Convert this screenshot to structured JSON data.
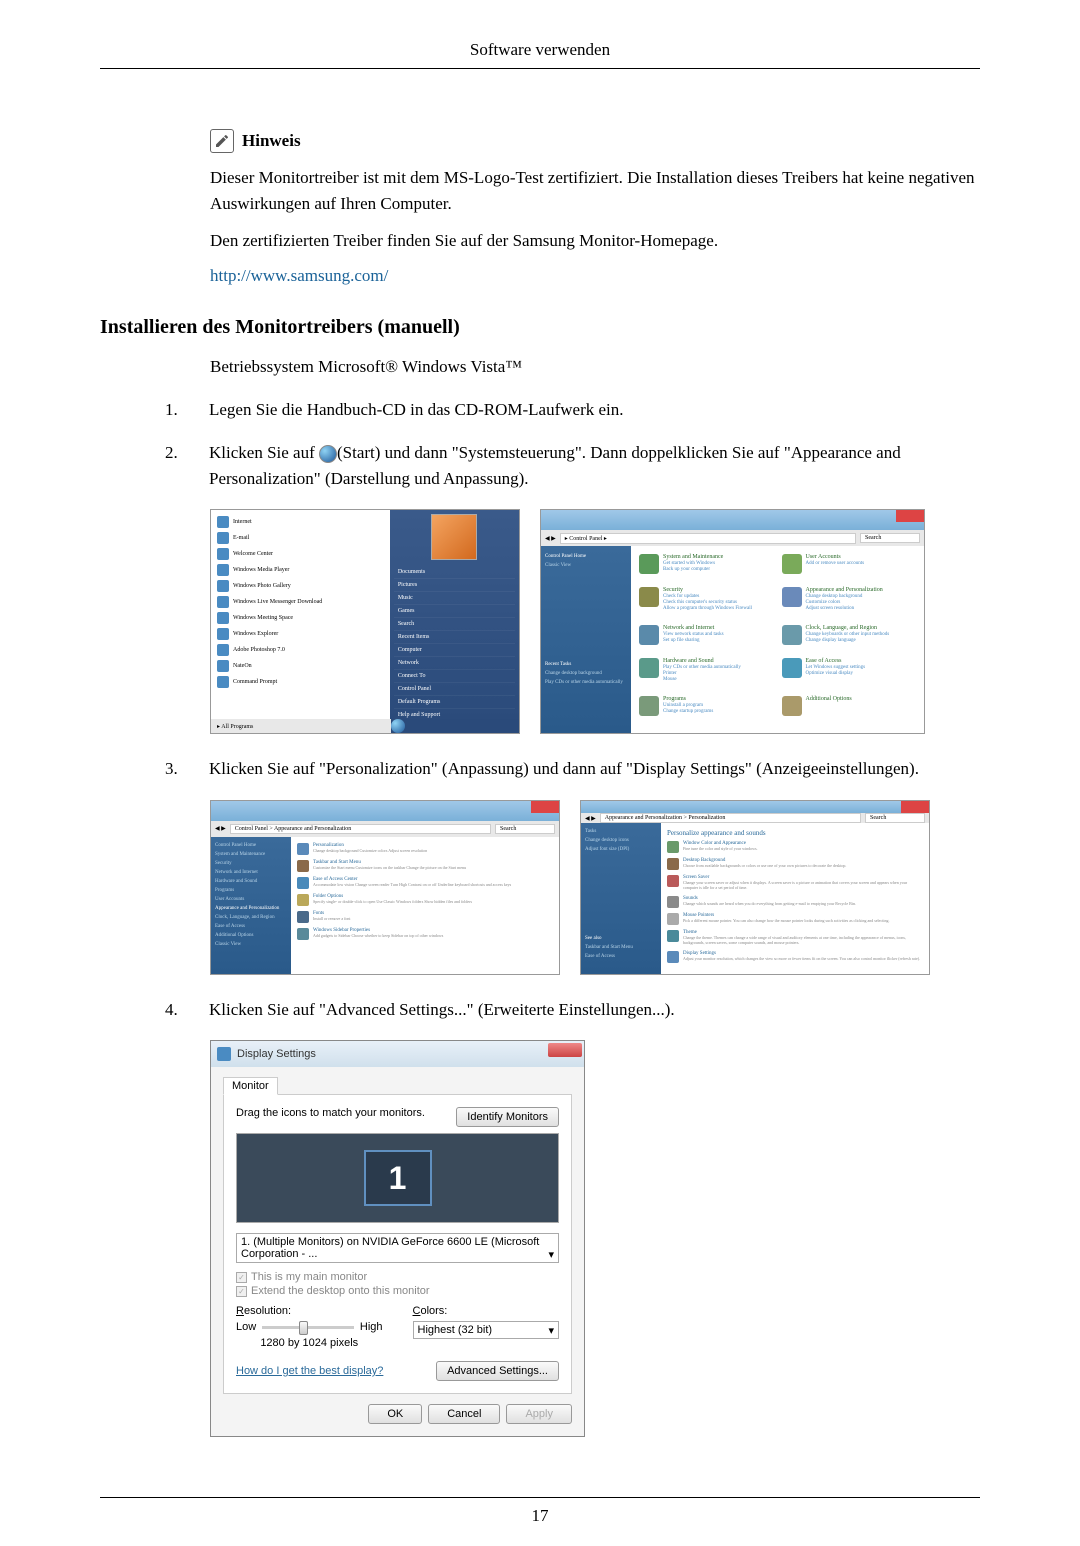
{
  "header_title": "Software verwenden",
  "hint": {
    "label": "Hinweis",
    "paragraph1": "Dieser Monitortreiber ist mit dem MS-Logo-Test zertifiziert. Die Installation dieses Treibers hat keine negativen Auswirkungen auf Ihren Computer.",
    "paragraph2": "Den zertifizierten Treiber finden Sie auf der Samsung Monitor-Homepage.",
    "url": "http://www.samsung.com/"
  },
  "section_heading": "Installieren des Monitortreibers (manuell)",
  "os_line": "Betriebssystem Microsoft® Windows Vista™",
  "steps": {
    "s1": {
      "num": "1.",
      "text": "Legen Sie die Handbuch-CD in das CD-ROM-Laufwerk ein."
    },
    "s2": {
      "num": "2.",
      "text_before": "Klicken Sie auf ",
      "text_after": "(Start) und dann \"Systemsteuerung\". Dann doppelklicken Sie auf \"Appearance and Personalization\" (Darstellung und Anpassung)."
    },
    "s3": {
      "num": "3.",
      "text": "Klicken Sie auf \"Personalization\" (Anpassung) und dann auf \"Display Settings\" (Anzeigeeinstellungen)."
    },
    "s4": {
      "num": "4.",
      "text": "Klicken Sie auf \"Advanced Settings...\" (Erweiterte Einstellungen...)."
    }
  },
  "startmenu": {
    "left_items": [
      "Internet",
      "E-mail",
      "Welcome Center",
      "Windows Media Player",
      "Windows Photo Gallery",
      "Windows Live Messenger Download",
      "Windows Meeting Space",
      "Windows Explorer",
      "Adobe Photoshop 7.0",
      "NateOn",
      "Command Prompt"
    ],
    "all_programs": "All Programs",
    "right_items": [
      "Documents",
      "Pictures",
      "Music",
      "Games",
      "Search",
      "Recent Items",
      "Computer",
      "Network",
      "Connect To",
      "Control Panel",
      "Default Programs",
      "Help and Support"
    ]
  },
  "control_panel": {
    "address": "Control Panel",
    "search": "Search",
    "sidebar_header": "Control Panel Home",
    "sidebar_items": [
      "Classic View"
    ],
    "sidebar_recent": "Recent Tasks",
    "sidebar_recent_items": [
      "Change desktop background",
      "Play CDs or other media automatically"
    ],
    "cats": [
      {
        "title": "System and Maintenance",
        "sub": "Get started with Windows\nBack up your computer",
        "color": "#5a9a5a"
      },
      {
        "title": "User Accounts",
        "sub": "Add or remove user accounts",
        "color": "#7aaa5a"
      },
      {
        "title": "Security",
        "sub": "Check for updates\nCheck this computer's security status\nAllow a program through Windows Firewall",
        "color": "#8a8a4a"
      },
      {
        "title": "Appearance and Personalization",
        "sub": "Change desktop background\nCustomize colors\nAdjust screen resolution",
        "color": "#6a8aba"
      },
      {
        "title": "Network and Internet",
        "sub": "View network status and tasks\nSet up file sharing",
        "color": "#5a8aaa"
      },
      {
        "title": "Clock, Language, and Region",
        "sub": "Change keyboards or other input methods\nChange display language",
        "color": "#6a9aaa"
      },
      {
        "title": "Hardware and Sound",
        "sub": "Play CDs or other media automatically\nPrinter\nMouse",
        "color": "#5a9a8a"
      },
      {
        "title": "Ease of Access",
        "sub": "Let Windows suggest settings\nOptimize visual display",
        "color": "#4a9aba"
      },
      {
        "title": "Programs",
        "sub": "Uninstall a program\nChange startup programs",
        "color": "#7a9a7a"
      },
      {
        "title": "Additional Options",
        "sub": "",
        "color": "#aa9a6a"
      }
    ]
  },
  "personalization1": {
    "address": "Control Panel > Appearance and Personalization",
    "sidebar": [
      "Control Panel Home",
      "System and Maintenance",
      "Security",
      "Network and Internet",
      "Hardware and Sound",
      "Programs",
      "User Accounts",
      "Appearance and Personalization",
      "Clock, Language, and Region",
      "Ease of Access",
      "Additional Options",
      "Classic View"
    ],
    "items": [
      {
        "title": "Personalization",
        "desc": "Change desktop background  Customize colors  Adjust screen resolution",
        "color": "#5a8aba"
      },
      {
        "title": "Taskbar and Start Menu",
        "desc": "Customize the Start menu  Customize icons on the taskbar  Change the picture on the Start menu",
        "color": "#8a6a4a"
      },
      {
        "title": "Ease of Access Center",
        "desc": "Accommodate low vision  Change screen reader  Turn High Contrast on or off  Underline keyboard shortcuts and access keys",
        "color": "#4a8aba"
      },
      {
        "title": "Folder Options",
        "desc": "Specify single- or double-click to open  Use Classic Windows folders  Show hidden files and folders",
        "color": "#baa85a"
      },
      {
        "title": "Fonts",
        "desc": "Install or remove a font",
        "color": "#4a6a8a"
      },
      {
        "title": "Windows Sidebar Properties",
        "desc": "Add gadgets to Sidebar  Choose whether to keep Sidebar on top of other windows",
        "color": "#5a8a9a"
      }
    ]
  },
  "personalization2": {
    "address": "Appearance and Personalization > Personalization",
    "heading": "Personalize appearance and sounds",
    "sidebar": [
      "Tasks",
      "Change desktop icons",
      "Adjust font size (DPI)"
    ],
    "items": [
      {
        "title": "Window Color and Appearance",
        "desc": "Fine tune the color and style of your windows.",
        "color": "#6a9a6a"
      },
      {
        "title": "Desktop Background",
        "desc": "Choose from available backgrounds or colors or use one of your own pictures to decorate the desktop.",
        "color": "#8a6a4a"
      },
      {
        "title": "Screen Saver",
        "desc": "Change your screen saver or adjust when it displays. A screen saver is a picture or animation that covers your screen and appears when your computer is idle for a set period of time.",
        "color": "#ba5a5a"
      },
      {
        "title": "Sounds",
        "desc": "Change which sounds are heard when you do everything from getting e-mail to emptying your Recycle Bin.",
        "color": "#8a8a8a"
      },
      {
        "title": "Mouse Pointers",
        "desc": "Pick a different mouse pointer. You can also change how the mouse pointer looks during such activities as clicking and selecting.",
        "color": "#aaaaaa"
      },
      {
        "title": "Theme",
        "desc": "Change the theme. Themes can change a wide range of visual and auditory elements at one time, including the appearance of menus, icons, backgrounds, screen savers, some computer sounds, and mouse pointers.",
        "color": "#4a8a9a"
      },
      {
        "title": "Display Settings",
        "desc": "Adjust your monitor resolution, which changes the view so more or fewer items fit on the screen. You can also control monitor flicker (refresh rate).",
        "color": "#5a8aba"
      }
    ],
    "see_also": "See also",
    "see_also_items": [
      "Taskbar and Start Menu",
      "Ease of Access"
    ]
  },
  "display_settings": {
    "title": "Display Settings",
    "tab": "Monitor",
    "drag_text": "Drag the icons to match your monitors.",
    "identify_button": "Identify Monitors",
    "monitor_number": "1",
    "monitor_select": "1. (Multiple Monitors) on NVIDIA GeForce 6600 LE (Microsoft Corporation - ...",
    "checkbox1": "This is my main monitor",
    "checkbox2": "Extend the desktop onto this monitor",
    "resolution_label": "Resolution:",
    "slider_low": "Low",
    "slider_high": "High",
    "resolution_value": "1280 by 1024 pixels",
    "colors_label": "Colors:",
    "colors_value": "Highest (32 bit)",
    "help_link": "How do I get the best display?",
    "advanced_button": "Advanced Settings...",
    "ok_button": "OK",
    "cancel_button": "Cancel",
    "apply_button": "Apply"
  },
  "page_number": "17"
}
